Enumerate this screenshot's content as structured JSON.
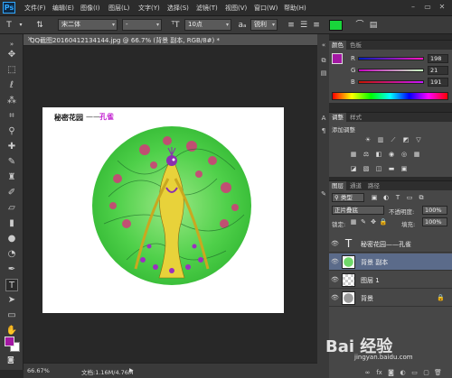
{
  "app": {
    "logo": "Ps"
  },
  "menu": [
    "文件(F)",
    "编辑(E)",
    "图像(I)",
    "图层(L)",
    "文字(Y)",
    "选择(S)",
    "滤镜(T)",
    "视图(V)",
    "窗口(W)",
    "帮助(H)"
  ],
  "window_buttons": [
    "–",
    "▭",
    "✕"
  ],
  "options": {
    "font_family": "宋二体",
    "font_style": "-",
    "font_size": "10点",
    "antialias": "锐利",
    "text_color": "#19d53b"
  },
  "document": {
    "tab_title": "QQ截图20160412134144.jpg @ 66.7% (背景 副本, RGB/8#) *",
    "canvas_title": "秘密花园",
    "canvas_dash": "——",
    "canvas_subtitle": "孔雀"
  },
  "status": {
    "zoom": "66.67%",
    "doc_size": "文档:1.16M/4.76M"
  },
  "color_panel": {
    "tabs": [
      "颜色",
      "色板"
    ],
    "r_label": "R",
    "r_value": "198",
    "g_label": "G",
    "g_value": "21",
    "b_label": "B",
    "b_value": "191",
    "foreground": "#a418a4"
  },
  "adjust_panel": {
    "tabs": [
      "调整",
      "样式"
    ],
    "add_label": "添加调整"
  },
  "layers_panel": {
    "tabs": [
      "图层",
      "通道",
      "路径"
    ],
    "kind_filter": "类型",
    "blend_mode": "正片叠底",
    "opacity_label": "不透明度:",
    "opacity_value": "100%",
    "lock_label": "锁定:",
    "fill_label": "填充:",
    "fill_value": "100%",
    "layers": [
      {
        "name": "秘密花园——孔雀",
        "type": "text",
        "visible": true,
        "selected": false
      },
      {
        "name": "背景 副本",
        "type": "image",
        "visible": true,
        "selected": true
      },
      {
        "name": "图层 1",
        "type": "transparent",
        "visible": true,
        "selected": false
      },
      {
        "name": "背景",
        "type": "background",
        "visible": true,
        "selected": false,
        "locked": true
      }
    ]
  },
  "watermark": {
    "brand": "Bai 经验",
    "url": "jingyan.baidu.com"
  }
}
